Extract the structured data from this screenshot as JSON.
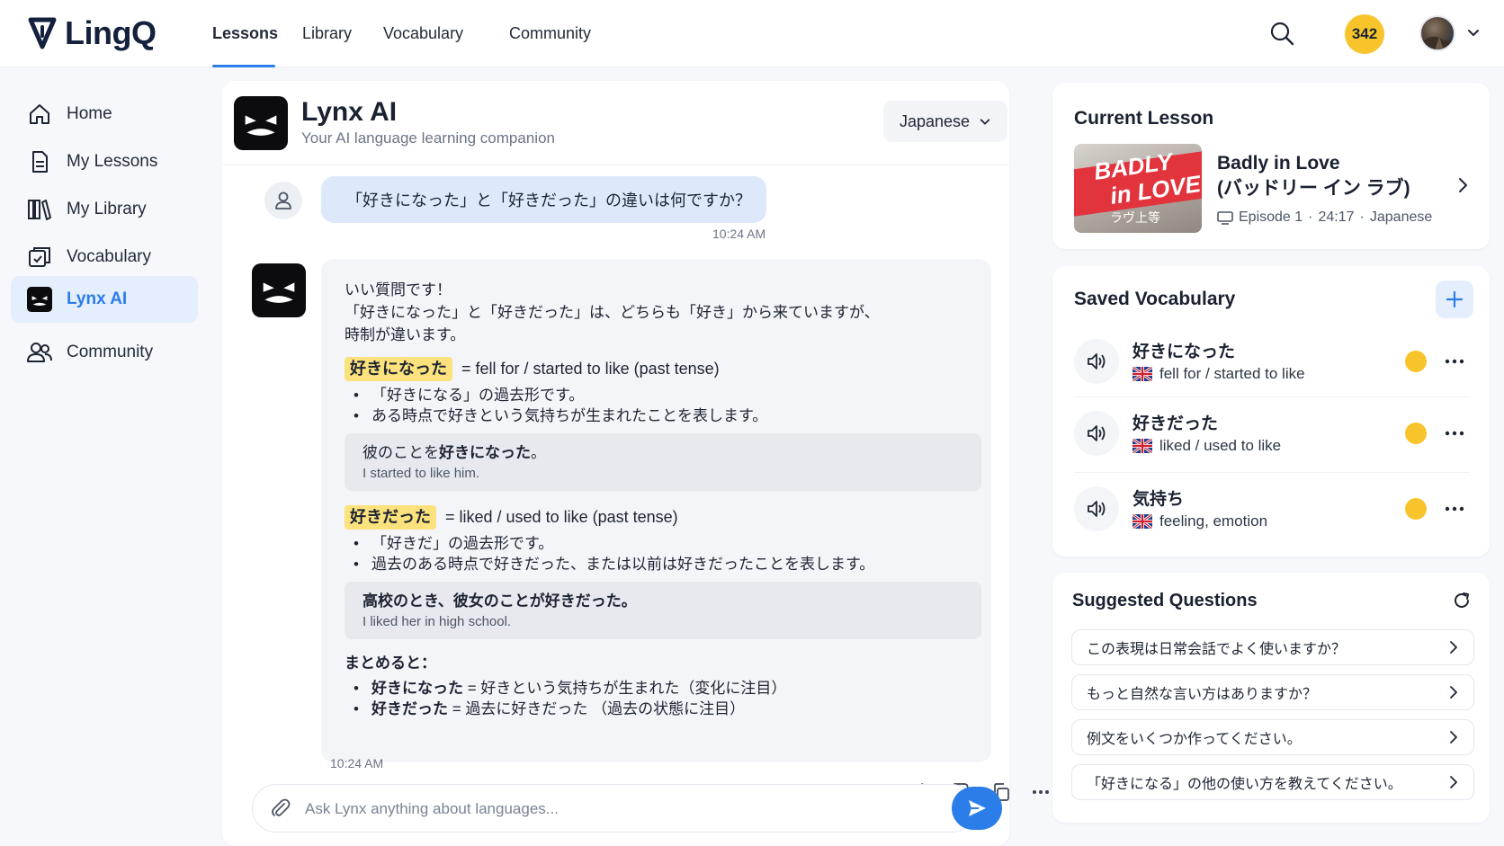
{
  "brand": {
    "name": "LingQ"
  },
  "nav": {
    "tabs": [
      {
        "label": "Lessons",
        "active": true
      },
      {
        "label": "Library",
        "active": false
      },
      {
        "label": "Vocabulary",
        "active": false
      },
      {
        "label": "Community",
        "active": false
      }
    ],
    "coins": "342",
    "icons": {
      "search": "search-icon",
      "chevron": "chevron-down-icon"
    }
  },
  "sidebar": {
    "items": [
      {
        "label": "Home",
        "icon": "home-icon",
        "active": false
      },
      {
        "label": "My Lessons",
        "icon": "document-icon",
        "active": false
      },
      {
        "label": "My Library",
        "icon": "books-icon",
        "active": false
      },
      {
        "label": "Vocabulary",
        "icon": "cards-icon",
        "active": false
      },
      {
        "label": "Lynx AI",
        "icon": "lynx-icon",
        "active": true
      },
      {
        "label": "Community",
        "icon": "users-icon",
        "active": false
      }
    ]
  },
  "chat": {
    "title": "Lynx AI",
    "subtitle": "Your AI language learning companion",
    "language": "Japanese",
    "user_message": "「好きになった」と「好きだった」の違いは何ですか？",
    "user_time": "10:24 AM",
    "ai": {
      "intro_1": "いい質問です！",
      "intro_2": "「好きになった」と「好きだった」は、どちらも「好き」から来ていますが、",
      "intro_3": "時制が違います。",
      "term1": {
        "word": "好きになった",
        "meaning": "= fell for / started to like (past tense)",
        "bullets": [
          "「好きになる」の過去形です。",
          "ある時点で好きという気持ちが生まれたことを表します。"
        ],
        "example_pre": "彼のことを",
        "example_bold": "好きになった",
        "example_post": "。",
        "example_en": "I started to like him."
      },
      "term2": {
        "word": "好きだった",
        "meaning": "= liked / used to like (past tense)",
        "bullets": [
          "「好きだ」の過去形です。",
          "過去のある時点で好きだった、または以前は好きだったことを表します。"
        ],
        "example_jp": "高校のとき、彼女のことが好きだった。",
        "example_en": "I liked her in high school."
      },
      "summary_title": "まとめると：",
      "summary": [
        {
          "word": "好きになった",
          "desc": "= 好きという気持ちが生まれた（変化に注目）"
        },
        {
          "word": "好きだった",
          "desc": "= 過去に好きだった （過去の状態に注目）"
        }
      ],
      "time": "10:24 AM"
    },
    "composer_placeholder": "Ask Lynx anything about languages..."
  },
  "current_lesson": {
    "heading": "Current Lesson",
    "thumb_line1": "BADLY",
    "thumb_line2": "in LOVE",
    "thumb_line3": "ラヴ上等",
    "title_en": "Badly in Love",
    "title_jp": "(バッドリー イン ラブ)",
    "episode": "Episode 1",
    "duration": "24:17",
    "language": "Japanese"
  },
  "vocab": {
    "heading": "Saved Vocabulary",
    "items": [
      {
        "word": "好きになった",
        "meaning": "fell for / started to like",
        "status_color": "#f7c52b"
      },
      {
        "word": "好きだった",
        "meaning": "liked / used to like",
        "status_color": "#f7c52b"
      },
      {
        "word": "気持ち",
        "meaning": "feeling, emotion",
        "status_color": "#f7c52b"
      }
    ]
  },
  "suggestions": {
    "heading": "Suggested Questions",
    "items": [
      "この表現は日常会話でよく使いますか？",
      "もっと自然な言い方はありますか？",
      "例文をいくつか作ってください。",
      "「好きになる」の他の使い方を教えてください。"
    ]
  },
  "colors": {
    "accent": "#2b7de9",
    "highlight": "#fbe27c",
    "coin": "#f7c52b"
  }
}
